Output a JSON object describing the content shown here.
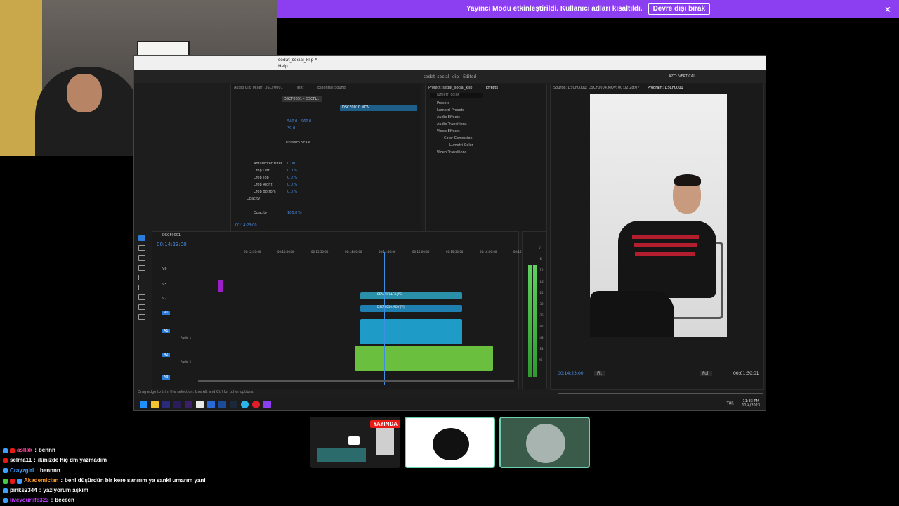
{
  "banner": {
    "message": "Yayıncı Modu etkinleştirildi. Kullanıcı adları kısaltıldı.",
    "button": "Devre dışı bırak",
    "close_icon": "×"
  },
  "premiere": {
    "window_title": "sedat_social_klip *",
    "menu_help": "Help",
    "app_title": "sedat_social_klip - Edited",
    "workspace": "AZO: VERTICAL",
    "effect_controls": {
      "tabs": [
        "Audio Clip Mixer: DSCF0001",
        "Text",
        "Essential Sound"
      ],
      "clip_tab": "DSCF0001 - DSCFL...",
      "clip_name": "DSCF0010.MOV",
      "position": [
        "540.0",
        "960.0"
      ],
      "scale": "39.0",
      "uniform_scale": "Uniform Scale",
      "rows": [
        {
          "label": "Anti-flicker Filter",
          "value": "0.00"
        },
        {
          "label": "Crop Left",
          "value": "0.0 %"
        },
        {
          "label": "Crop Top",
          "value": "0.0 %"
        },
        {
          "label": "Crop Right",
          "value": "0.0 %"
        },
        {
          "label": "Crop Bottom",
          "value": "0.0 %"
        }
      ],
      "opacity_header": "Opacity",
      "opacity": {
        "label": "Opacity",
        "value": "100.0 %"
      },
      "timecode": "00:14:23:00"
    },
    "effects_panel": {
      "tabs": [
        "Project: sedat_social_klip",
        "Effects"
      ],
      "search": "lumetri color",
      "tree": [
        "Presets",
        "Lumetri Presets",
        "Audio Effects",
        "Audio Transitions",
        "Video Effects",
        "Color Correction",
        "Lumetri Color",
        "Video Transitions"
      ]
    },
    "program": {
      "source_label": "Source: DSCF0001: DSCF0004.MOV: 00:02:28:07",
      "program_label": "Program: DSCF0001",
      "timecode_current": "00:14:23:00",
      "fit": "Fit",
      "quality": "Full",
      "timecode_duration": "00:01:30:01"
    },
    "timeline": {
      "sequence": "DSCF0001",
      "timecode": "00:14:23:00",
      "ruler": [
        "00:12:30:00",
        "00:13:00:00",
        "00:13:30:00",
        "00:14:00:00",
        "00:14:30:00",
        "00:15:00:00",
        "00:15:30:00",
        "00:16:00:00",
        "00:16:3"
      ],
      "tracks": [
        "V6",
        "V5",
        "V2",
        "V1",
        "A1",
        "A2",
        "A3"
      ],
      "track_names": [
        "Audio 1",
        "Audio 2"
      ],
      "clips": [
        "BEAUTIFULFX.JPG",
        "DSCF0010.MOV [V]"
      ]
    },
    "meter_scale": [
      "0",
      "-6",
      "-12",
      "-18",
      "-24",
      "-30",
      "-36",
      "-42",
      "-48",
      "-54",
      "dB"
    ],
    "status": "Drag edge to trim the selection. Use Alt and Ctrl for other options.",
    "taskbar": {
      "lang": "TUR",
      "time": "11:33 PM",
      "date": "11/4/2023"
    }
  },
  "thumbnails": {
    "live_badge": "YAYINDA"
  },
  "chat": [
    {
      "user": "asllak",
      "message": "bennn",
      "color": "#ff4fa0"
    },
    {
      "user": "selma11",
      "message": "ikinizde hiç dm yazmadım",
      "color": "#ffffff"
    },
    {
      "user": "Crayzgirl",
      "message": "bennnn",
      "color": "#3ea1ff"
    },
    {
      "user": "Akademician",
      "message": "beni düşürdün bir kere sanırım ya sanki umarım yani",
      "color": "#ff9c2b"
    },
    {
      "user": "pinks2344",
      "message": "yazıyorum aşkım",
      "color": "#ffffff"
    },
    {
      "user": "liveyourlife323",
      "message": "beeeen",
      "color": "#c43cff"
    }
  ],
  "colors": {
    "accent": "#8c3ff0",
    "live": "#e91916",
    "video_clip": "#1f8fb8",
    "audio_clip": "#6bbf3e"
  }
}
